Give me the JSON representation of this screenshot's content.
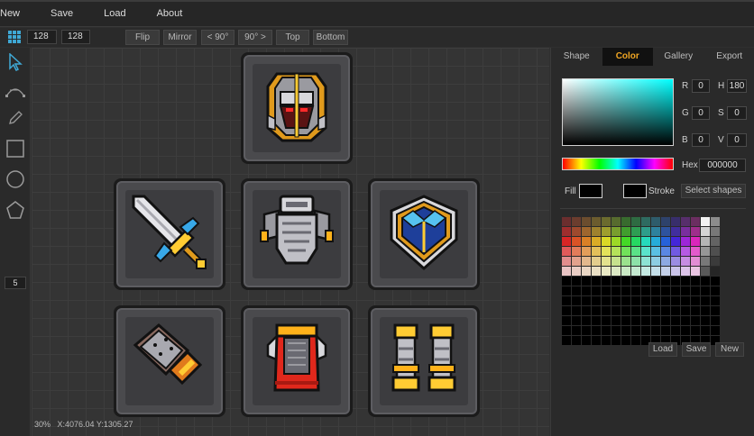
{
  "menu": [
    "New",
    "Save",
    "Load",
    "About"
  ],
  "toolbar": {
    "width": "128",
    "height": "128",
    "buttons": [
      "Flip",
      "Mirror",
      "< 90°",
      "90° >",
      "Top",
      "Bottom"
    ]
  },
  "tools": {
    "icons": [
      "select-arrow-icon",
      "bezier-curve-icon",
      "pen-icon",
      "rectangle-icon",
      "circle-icon",
      "pentagon-icon"
    ],
    "polygon_sides": "5"
  },
  "canvas": {
    "tiles": [
      {
        "name": "helmet"
      },
      {
        "name": "sword"
      },
      {
        "name": "chest-armor"
      },
      {
        "name": "shield"
      },
      {
        "name": "gauntlet"
      },
      {
        "name": "cape"
      },
      {
        "name": "boots"
      }
    ]
  },
  "status": {
    "zoom": "30%",
    "coords": "X:4076.04 Y:1305.27"
  },
  "panel": {
    "tabs": [
      "Shape",
      "Color",
      "Gallery",
      "Export"
    ],
    "active_tab": "Color",
    "color": {
      "r_label": "R",
      "r": "0",
      "g_label": "G",
      "g": "0",
      "b_label": "B",
      "b": "0",
      "h_label": "H",
      "h": "180",
      "s_label": "S",
      "s": "0",
      "v_label": "V",
      "v": "0",
      "hex_label": "Hex",
      "hex": "000000"
    },
    "fill_label": "Fill",
    "stroke_label": "Stroke",
    "fill_color": "#000000",
    "stroke_color": "#000000",
    "select_shapes": "Select shapes",
    "palette_buttons": [
      "Load",
      "Save",
      "New"
    ],
    "accent": "#f0a623"
  }
}
